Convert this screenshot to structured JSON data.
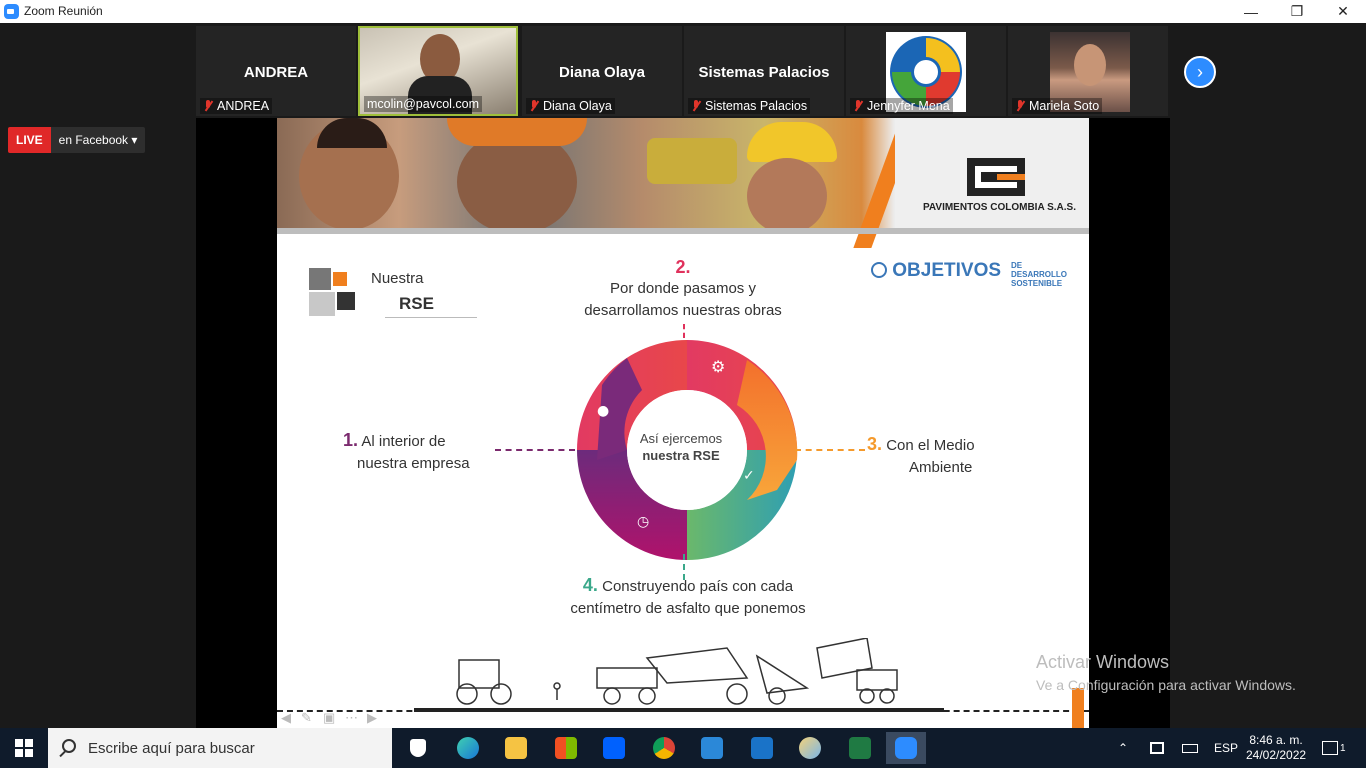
{
  "window": {
    "title": "Zoom Reunión"
  },
  "participants": [
    {
      "big_name": "ANDREA",
      "label": "ANDREA",
      "video": false
    },
    {
      "big_name": "",
      "label": "mcolin@pavcol.com",
      "video": true
    },
    {
      "big_name": "Diana Olaya",
      "label": "Diana Olaya",
      "video": false
    },
    {
      "big_name": "Sistemas Palacios",
      "label": "Sistemas Palacios",
      "video": false
    },
    {
      "big_name": "",
      "label": "Jennyfer Mena",
      "video": true
    },
    {
      "big_name": "",
      "label": "Mariela Soto",
      "video": true
    }
  ],
  "live": {
    "badge": "LIVE",
    "where": "en Facebook"
  },
  "slide": {
    "company": "PAVIMENTOS COLOMBIA S.A.S.",
    "title_line1": "Nuestra",
    "title_line2": "RSE",
    "ods_main": "OBJETIVOS",
    "ods_small1": "DE DESARROLLO",
    "ods_small2": "SOSTENIBLE",
    "center1": "Así ejercemos",
    "center2": "nuestra RSE",
    "items": [
      {
        "num": "1.",
        "text1": "Al interior de",
        "text2": "nuestra empresa",
        "color": "#7b2a6e"
      },
      {
        "num": "2.",
        "text1": "Por donde pasamos y",
        "text2": "desarrollamos nuestras obras",
        "color": "#e0315c"
      },
      {
        "num": "3.",
        "text1": "Con el Medio",
        "text2": "Ambiente",
        "color": "#f59a2c"
      },
      {
        "num": "4.",
        "text1": "Construyendo país con cada",
        "text2": "centímetro de asfalto que ponemos",
        "color": "#3aa88a"
      }
    ]
  },
  "watermark": {
    "line1": "Activar Windows",
    "line2": "Ve a Configuración para activar Windows."
  },
  "taskbar": {
    "search_placeholder": "Escribe aquí para buscar",
    "lang": "ESP",
    "time": "8:46 a. m.",
    "date": "24/02/2022",
    "notifications": "1"
  }
}
